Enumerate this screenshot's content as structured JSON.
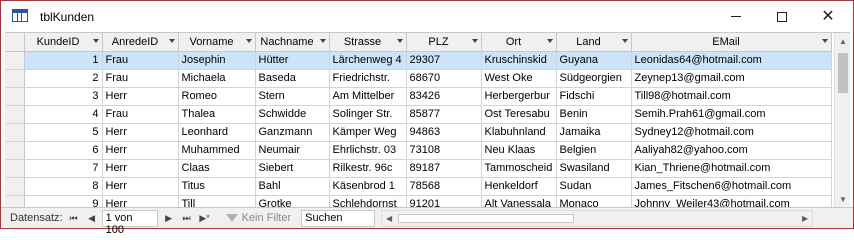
{
  "window": {
    "title": "tblKunden"
  },
  "columns": [
    {
      "label": "KundeID"
    },
    {
      "label": "AnredeID"
    },
    {
      "label": "Vorname"
    },
    {
      "label": "Nachname"
    },
    {
      "label": "Strasse"
    },
    {
      "label": "PLZ"
    },
    {
      "label": "Ort"
    },
    {
      "label": "Land"
    },
    {
      "label": "EMail"
    }
  ],
  "rows": [
    [
      "1",
      "Frau",
      "Josephin",
      "Hütter",
      "Lärchenweg 4",
      "29307",
      "Kruschinskid",
      "Guyana",
      "Leonidas64@hotmail.com"
    ],
    [
      "2",
      "Frau",
      "Michaela",
      "Baseda",
      "Friedrichstr.",
      "68670",
      "West Oke",
      "Südgeorgien",
      "Zeynep13@gmail.com"
    ],
    [
      "3",
      "Herr",
      "Romeo",
      "Stern",
      "Am Mittelber",
      "83426",
      "Herbergerbur",
      "Fidschi",
      "Till98@hotmail.com"
    ],
    [
      "4",
      "Frau",
      "Thalea",
      "Schwidde",
      "Solinger Str.",
      "85877",
      "Ost Teresabu",
      "Benin",
      "Semih.Prah61@gmail.com"
    ],
    [
      "5",
      "Herr",
      "Leonhard",
      "Ganzmann",
      "Kämper Weg",
      "94863",
      "Klabuhnland",
      "Jamaika",
      "Sydney12@hotmail.com"
    ],
    [
      "6",
      "Herr",
      "Muhammed",
      "Neumair",
      "Ehrlichstr. 03",
      "73108",
      "Neu Klaas",
      "Belgien",
      "Aaliyah82@yahoo.com"
    ],
    [
      "7",
      "Herr",
      "Claas",
      "Siebert",
      "Rilkestr. 96c",
      "89187",
      "Tammoscheid",
      "Swasiland",
      "Kian_Thriene@hotmail.com"
    ],
    [
      "8",
      "Herr",
      "Titus",
      "Bahl",
      "Käsenbrod 1",
      "78568",
      "Henkeldorf",
      "Sudan",
      "James_Fitschen6@hotmail.com"
    ],
    [
      "9",
      "Herr",
      "Till",
      "Grotke",
      "Schlehdornst",
      "91201",
      "Alt Vanessala",
      "Monaco",
      "Johnny_Weiler43@hotmail.com"
    ]
  ],
  "nav": {
    "label": "Datensatz:",
    "first": "⏮",
    "prev": "◀",
    "record": "1 von 100",
    "next": "▶",
    "last": "⏭",
    "new": "▶*",
    "filter": "Kein Filter",
    "search": "Suchen"
  }
}
